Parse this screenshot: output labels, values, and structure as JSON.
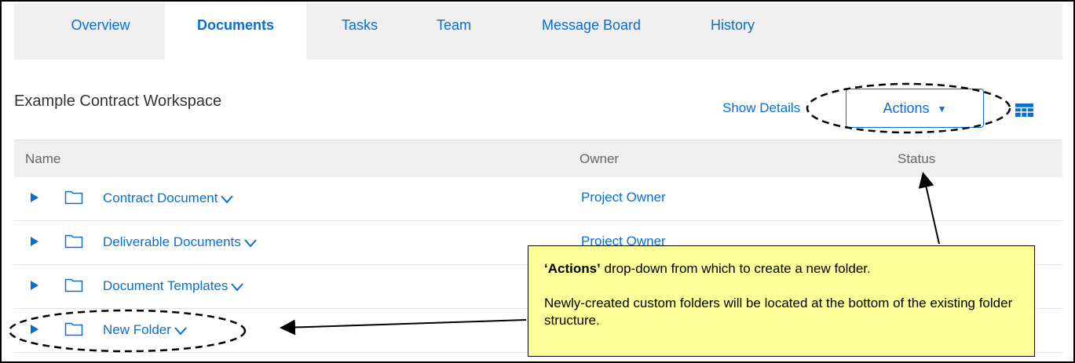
{
  "tabs": [
    {
      "label": "Overview",
      "active": false
    },
    {
      "label": "Documents",
      "active": true
    },
    {
      "label": "Tasks",
      "active": false
    },
    {
      "label": "Team",
      "active": false
    },
    {
      "label": "Message Board",
      "active": false
    },
    {
      "label": "History",
      "active": false
    }
  ],
  "workspace": {
    "title": "Example Contract Workspace",
    "show_details_label": "Show Details",
    "actions_label": "Actions"
  },
  "table": {
    "columns": [
      "Name",
      "Owner",
      "Status"
    ],
    "rows": [
      {
        "name": "Contract Document",
        "owner": "Project Owner"
      },
      {
        "name": "Deliverable Documents",
        "owner": "Project Owner"
      },
      {
        "name": "Document Templates",
        "owner": ""
      },
      {
        "name": "New Folder",
        "owner": ""
      }
    ]
  },
  "callout": {
    "bold_text": "‘Actions’",
    "line1_rest": " drop-down from which to create a new folder.",
    "line2": "Newly-created custom folders will be located at the bottom of the existing folder structure."
  },
  "colors": {
    "link": "#0a6ed1",
    "tab_bar": "#efefef",
    "callout_bg": "#ffff99"
  },
  "icons": [
    "expand-arrow-icon",
    "folder-icon",
    "chevron-down-icon",
    "table-grid-icon",
    "caret-down-icon"
  ]
}
